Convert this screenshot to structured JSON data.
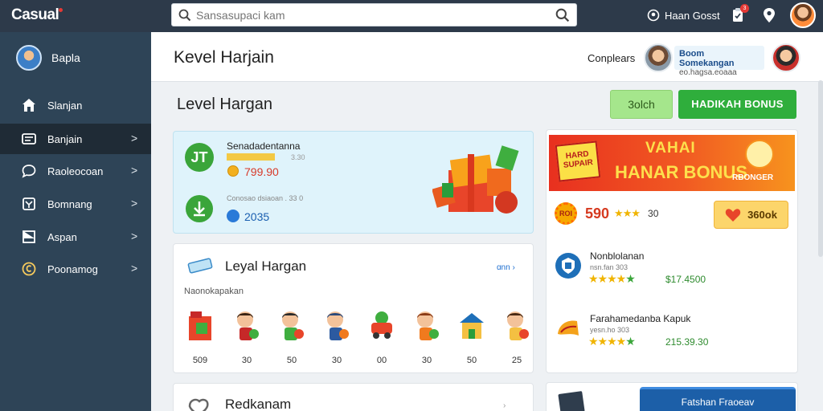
{
  "app": {
    "logo": "Casual"
  },
  "search": {
    "placeholder": "Sansasupaci kam"
  },
  "topbar": {
    "user_label": "Haan Gosst",
    "notif_count": "3"
  },
  "sidebar": {
    "profile_name": "Bapla",
    "items": [
      {
        "label": "Slanjan",
        "icon": "home-icon",
        "chevron": ""
      },
      {
        "label": "Banjain",
        "icon": "list-icon",
        "chevron": ">"
      },
      {
        "label": "Raoleocoan",
        "icon": "chat-icon",
        "chevron": ">"
      },
      {
        "label": "Bomnang",
        "icon": "box-icon",
        "chevron": ">"
      },
      {
        "label": "Aspan",
        "icon": "flag-icon",
        "chevron": ">"
      },
      {
        "label": "Poonamog",
        "icon": "coin-icon",
        "chevron": ">"
      }
    ],
    "active_index": 1
  },
  "header": {
    "title": "Kevel Harjain",
    "compare_label": "Conplears",
    "tag_title": "Boom Somekangan",
    "tag_sub": "eo.hagsa.eoaaa"
  },
  "main": {
    "title": "Level Hargan",
    "btn_light": "3olch",
    "btn_bonus": "HADIKAH BONUS"
  },
  "card1": {
    "row1_icon": "JT",
    "row1_title": "Senadadentanna",
    "row1_small": "3.30",
    "row1_price": "799.90",
    "row2_small": "Conosao dsiaoan . 33 0",
    "row2_value": "2035"
  },
  "card2": {
    "title": "Leyal Hargan",
    "more": "ɑnn ›",
    "subtitle": "Naonokapakan",
    "items": [
      {
        "label": "509",
        "kind": "bag"
      },
      {
        "label": "30",
        "kind": "kid"
      },
      {
        "label": "50",
        "kind": "kid"
      },
      {
        "label": "30",
        "kind": "kid"
      },
      {
        "label": "00",
        "kind": "car"
      },
      {
        "label": "30",
        "kind": "kid"
      },
      {
        "label": "50",
        "kind": "house"
      },
      {
        "label": "25",
        "kind": "kid"
      }
    ]
  },
  "card3": {
    "title": "Redkanam",
    "arrow": "›"
  },
  "right": {
    "banner_badge": "HARD SUPAIR",
    "banner_t1": "VAHAI",
    "banner_t2": "HANAR BONUS",
    "banner_small": "RBONGER",
    "sun_label": "ROI",
    "points": "590",
    "stars": "★★★",
    "num": "30",
    "heart_btn": "360ok",
    "rows": [
      {
        "title": "Nonblolanan",
        "sub": "nsn.fan 303",
        "price": "$17.4500",
        "icon": "shield-icon"
      },
      {
        "title": "Farahamedanba Kapuk",
        "sub": "yesn.ho 303",
        "price": "215.39.30",
        "icon": "horn-icon"
      }
    ],
    "cta": "Fatshan Fraoeav"
  }
}
